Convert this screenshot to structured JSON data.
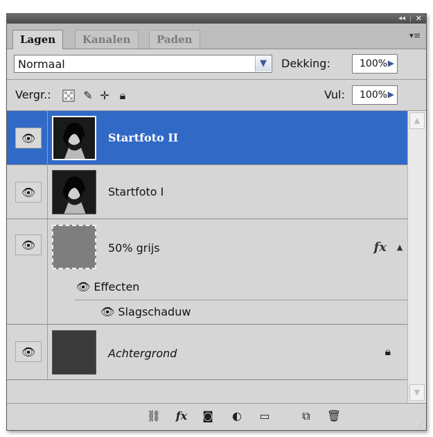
{
  "titlebar": {
    "collapse_glyph": "◂◂",
    "close_glyph": "✕"
  },
  "tabs": [
    {
      "label": "Lagen",
      "active": true
    },
    {
      "label": "Kanalen",
      "active": false
    },
    {
      "label": "Paden",
      "active": false
    }
  ],
  "panel_menu_icon": "panel-menu-icon",
  "blend": {
    "value": "Normaal",
    "opacity_label": "Dekking:",
    "opacity_value": "100%"
  },
  "lock": {
    "label": "Vergr.:",
    "fill_label": "Vul:",
    "fill_value": "100%"
  },
  "layers": [
    {
      "name": "Startfoto II",
      "selected": true,
      "visible": true,
      "thumb": "photo"
    },
    {
      "name": "Startfoto I",
      "selected": false,
      "visible": true,
      "thumb": "photo"
    },
    {
      "name": "50% grijs",
      "selected": false,
      "visible": true,
      "thumb": "gray",
      "fx": "fx",
      "effects_label": "Effecten",
      "effect_items": [
        "Slagschaduw"
      ]
    },
    {
      "name": "Achtergrond",
      "selected": false,
      "visible": true,
      "thumb": "dark",
      "locked": true
    }
  ],
  "colors": {
    "selection": "#3169c6",
    "panel_bg": "#d6d6d6"
  }
}
